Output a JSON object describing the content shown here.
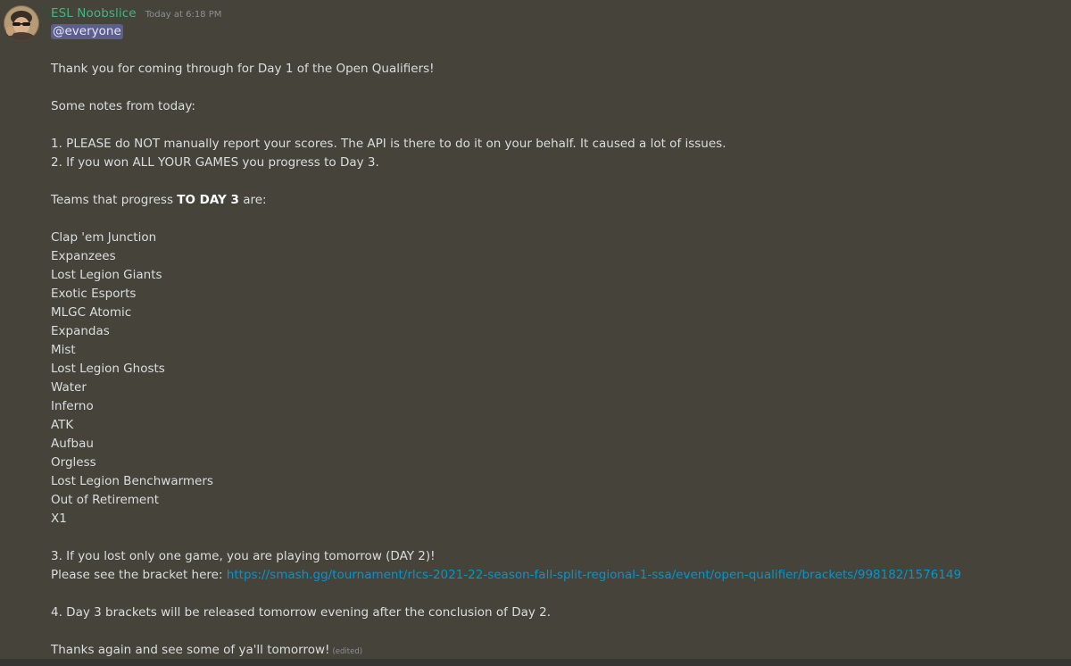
{
  "message": {
    "author": "ESL Noobslice",
    "timestamp": "Today at 6:18 PM",
    "mention": "@everyone",
    "thanks_line": "Thank you for coming through for Day 1 of the Open Qualifiers!",
    "notes_heading": "Some notes from today:",
    "note_1": "1. PLEASE do NOT manually report your scores. The API is there to do it on your behalf. It caused a lot of issues.",
    "note_2": "2. If you won ALL YOUR GAMES you progress to Day 3.",
    "teams_prefix": "Teams that progress ",
    "teams_bold": "TO DAY 3",
    "teams_suffix": " are:",
    "teams": [
      "Clap 'em Junction",
      "Expanzees",
      "Lost Legion Giants",
      "Exotic Esports",
      "MLGC Atomic",
      "Expandas",
      "Mist",
      "Lost Legion Ghosts",
      "Water",
      "Inferno",
      "ATK",
      "Aufbau",
      "Orgless",
      "Lost Legion Benchwarmers",
      "Out of Retirement",
      "X1"
    ],
    "note_3": "3. If you lost only one game, you are playing tomorrow (DAY 2)!",
    "bracket_prefix": "Please see the bracket here:",
    "bracket_link": "https://smash.gg/tournament/rlcs-2021-22-season-fall-split-regional-1-ssa/event/open-qualifier/brackets/998182/1576149",
    "note_4": "4. Day 3 brackets will be released tomorrow evening after the conclusion of Day 2.",
    "closing": "Thanks again and see some of ya'll tomorrow!",
    "edited_label": "(edited)"
  },
  "colors": {
    "background": "#46433b",
    "username": "#43b581",
    "link": "#0096cf",
    "mention_bg": "#5b5e8e"
  },
  "icons": {
    "avatar": "user-avatar"
  }
}
